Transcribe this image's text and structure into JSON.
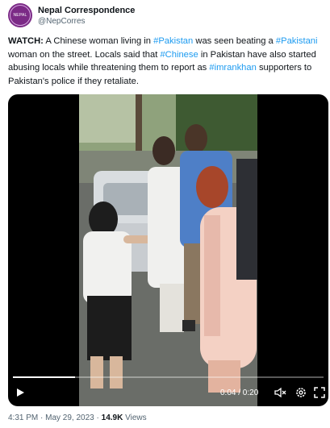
{
  "account": {
    "name": "Nepal Correspondence",
    "handle": "@NepCorres",
    "avatar_text": "NEPAL"
  },
  "tweet": {
    "watch": "WATCH:",
    "p1": " A Chinese woman living in ",
    "h1": "#Pakistan",
    "p2": " was seen beating a ",
    "h2": "#Pakistani",
    "p3": " woman on the street. Locals said that ",
    "h3": "#Chinese",
    "p4": " in Pakistan have also started abusing locals while threatening them to report as ",
    "h4": "#imrankhan",
    "p5": " supporters to Pakistan's police if they retaliate."
  },
  "video": {
    "time": "0:04 / 0:20",
    "progress": 0.2
  },
  "footer": {
    "time": "4:31 PM",
    "sep1": " · ",
    "date": "May 29, 2023",
    "sep2": " · ",
    "views_count": "14.9K",
    "views_label": " Views"
  },
  "colors": {
    "link": "#1d9bf0",
    "muted": "#536471",
    "avatar": "#7b2a86"
  }
}
